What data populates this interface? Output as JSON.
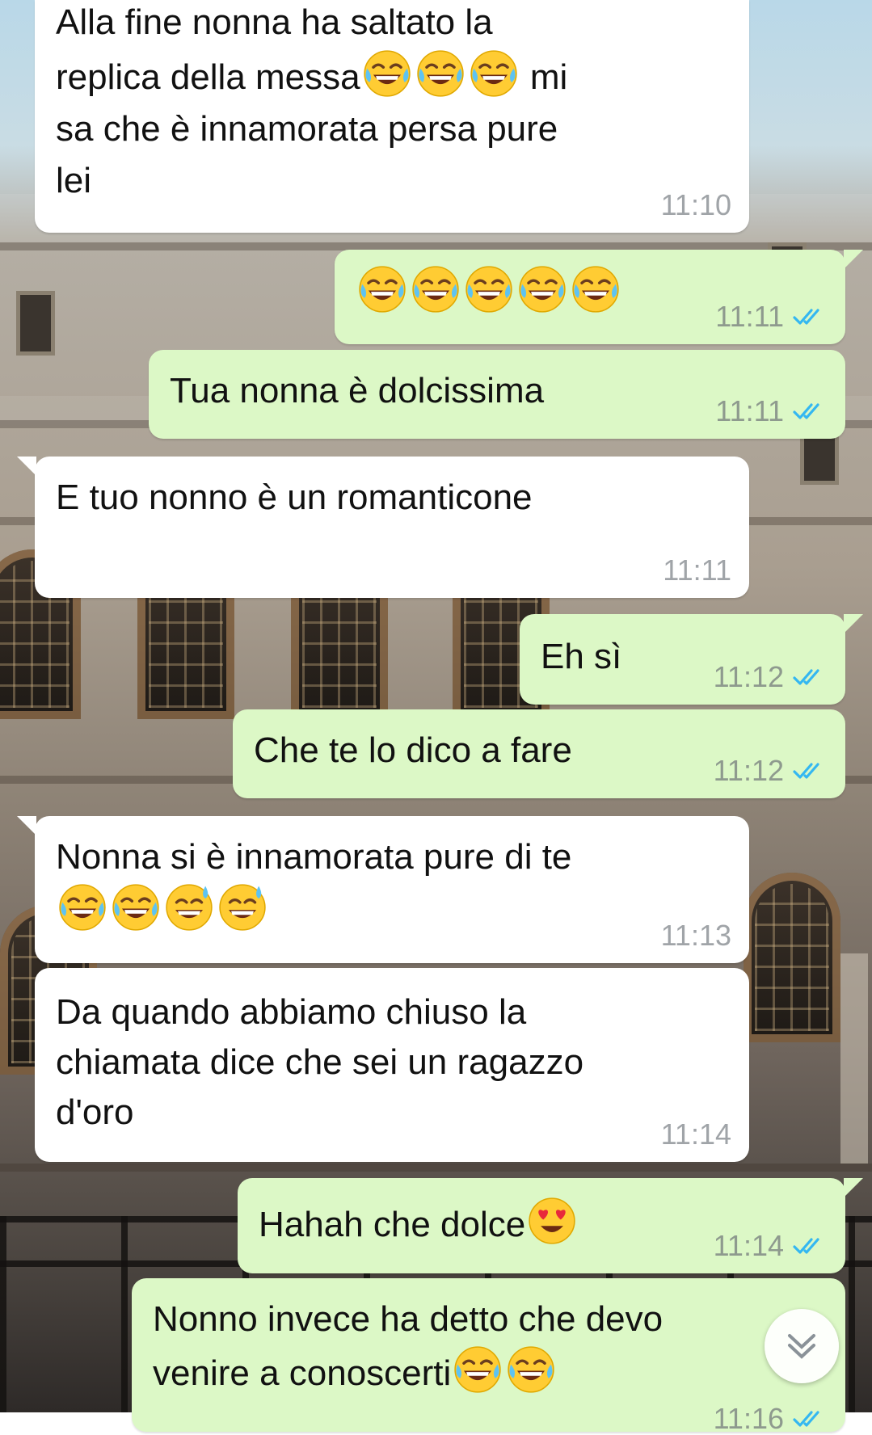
{
  "messages": [
    {
      "dir": "in",
      "text": "Alla fine nonna ha saltato la\nreplica della messa",
      "emoji_after": [
        "laugh",
        "laugh",
        "laugh"
      ],
      "text_after": " mi\nsa che è innamorata persa pure\nlei",
      "time": "11:10"
    },
    {
      "dir": "out",
      "text": "",
      "emoji": [
        "laugh",
        "laugh",
        "laugh",
        "laugh",
        "laugh"
      ],
      "time": "11:11",
      "status": "read"
    },
    {
      "dir": "out",
      "text": "Tua nonna è dolcissima",
      "time": "11:11",
      "status": "read"
    },
    {
      "dir": "in",
      "text": "E tuo nonno è un romanticone",
      "time": "11:11"
    },
    {
      "dir": "out",
      "text": "Eh sì",
      "time": "11:12",
      "status": "read"
    },
    {
      "dir": "out",
      "text": "Che te lo dico a fare",
      "time": "11:12",
      "status": "read"
    },
    {
      "dir": "in",
      "text": "Nonna si è innamorata pure di te",
      "emoji": [
        "laugh",
        "laugh",
        "sweat-smile",
        "sweat-smile"
      ],
      "time": "11:13"
    },
    {
      "dir": "in",
      "text": "Da quando abbiamo chiuso la\nchiamata dice che sei un ragazzo\nd'oro",
      "time": "11:14"
    },
    {
      "dir": "out",
      "text": "Hahah che dolce",
      "emoji": [
        "heart-eyes"
      ],
      "time": "11:14",
      "status": "read"
    },
    {
      "dir": "out",
      "text": "Nonno invece ha detto che devo\nvenire a conoscerti",
      "emoji": [
        "laugh",
        "laugh"
      ],
      "time": "11:16",
      "status": "read"
    }
  ],
  "colors": {
    "incoming": "#ffffff",
    "outgoing": "#dcf8c6",
    "read_ticks": "#34b7f1"
  },
  "icons": {
    "scroll_down": "chevron-double-down-icon",
    "read_status": "double-check-icon"
  }
}
